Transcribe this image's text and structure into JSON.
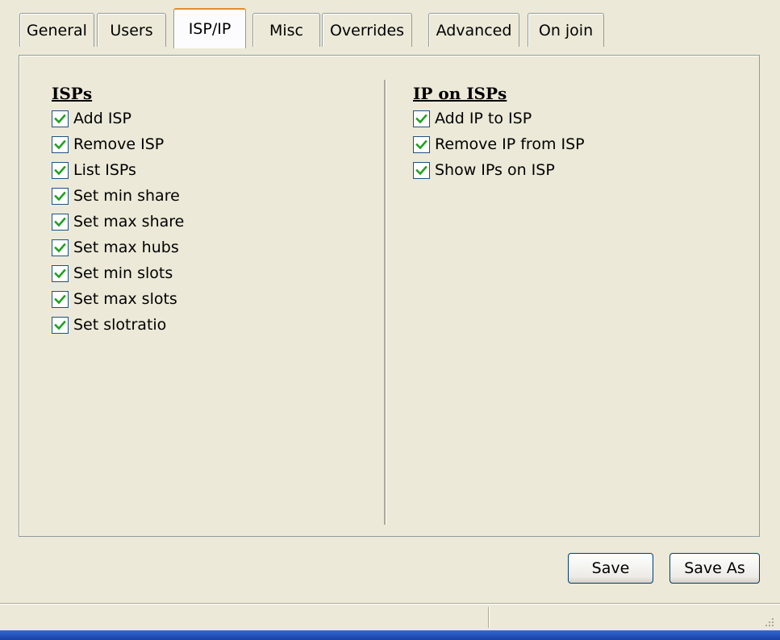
{
  "tabs": [
    {
      "label": "General",
      "active": false
    },
    {
      "label": "Users",
      "active": false
    },
    {
      "label": "ISP/IP",
      "active": true
    },
    {
      "label": "Misc",
      "active": false
    },
    {
      "label": "Overrides",
      "active": false
    },
    {
      "label": "Advanced",
      "active": false
    },
    {
      "label": "On join",
      "active": false
    }
  ],
  "isps_group": {
    "title": "ISPs",
    "items": [
      {
        "label": "Add ISP",
        "checked": true
      },
      {
        "label": "Remove ISP",
        "checked": true
      },
      {
        "label": "List ISPs",
        "checked": true
      },
      {
        "label": "Set min share",
        "checked": true
      },
      {
        "label": "Set max share",
        "checked": true
      },
      {
        "label": "Set max hubs",
        "checked": true
      },
      {
        "label": "Set min slots",
        "checked": true
      },
      {
        "label": "Set max slots",
        "checked": true
      },
      {
        "label": "Set slotratio",
        "checked": true
      }
    ]
  },
  "ip_group": {
    "title": "IP on ISPs",
    "items": [
      {
        "label": "Add IP to ISP",
        "checked": true
      },
      {
        "label": "Remove IP from ISP",
        "checked": true
      },
      {
        "label": "Show IPs on ISP",
        "checked": true
      }
    ]
  },
  "buttons": {
    "save": "Save",
    "save_as": "Save As"
  },
  "colors": {
    "check_mark": "#21a121",
    "active_tab_accent": "#e68b2c",
    "window_bg": "#ece9d8"
  }
}
